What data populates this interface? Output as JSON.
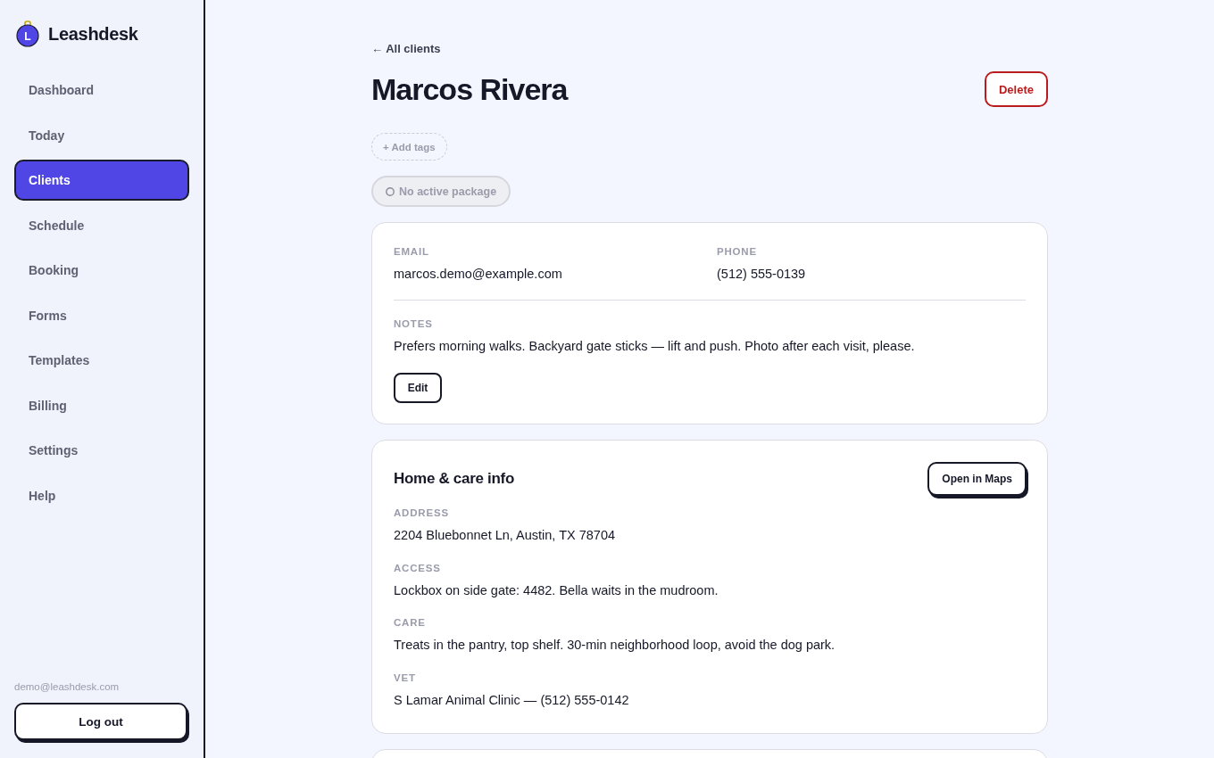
{
  "sidebar": {
    "brand": {
      "logo_letter": "L",
      "name": "Leashdesk"
    },
    "nav_items": [
      {
        "label": "Dashboard",
        "selected": false
      },
      {
        "label": "Today",
        "selected": false
      },
      {
        "label": "Clients",
        "selected": true
      },
      {
        "label": "Schedule",
        "selected": false
      },
      {
        "label": "Booking",
        "selected": false
      },
      {
        "label": "Forms",
        "selected": false
      },
      {
        "label": "Templates",
        "selected": false
      },
      {
        "label": "Billing",
        "selected": false
      },
      {
        "label": "Settings",
        "selected": false
      },
      {
        "label": "Help",
        "selected": false
      }
    ],
    "account_email": "demo@leashdesk.com",
    "logout_button": "Log out"
  },
  "header": {
    "back_link": "← All clients",
    "title": "Marcos Rivera",
    "delete_button": "Delete"
  },
  "add_tags_button": "+ Add tags",
  "package_badge": "No active package",
  "contact_card": {
    "fields": [
      {
        "label": "EMAIL",
        "value": "marcos.demo@example.com"
      },
      {
        "label": "PHONE",
        "value": "(512) 555-0139"
      }
    ],
    "notes": {
      "label": "NOTES",
      "value": "Prefers morning walks. Backyard gate sticks — lift and push. Photo after each visit, please."
    },
    "edit_button": "Edit"
  },
  "home_card": {
    "title": "Home & care info",
    "maps_button": "Open in Maps",
    "fields": [
      {
        "label": "ADDRESS",
        "value": "2204 Bluebonnet Ln, Austin, TX 78704"
      },
      {
        "label": "ACCESS",
        "value": "Lockbox on side gate: 4482. Bella waits in the mudroom."
      },
      {
        "label": "CARE",
        "value": "Treats in the pantry, top shelf. 30-min neighborhood loop, avoid the dog park."
      },
      {
        "label": "VET",
        "value": "S Lamar Animal Clinic — (512) 555-0142"
      }
    ]
  }
}
